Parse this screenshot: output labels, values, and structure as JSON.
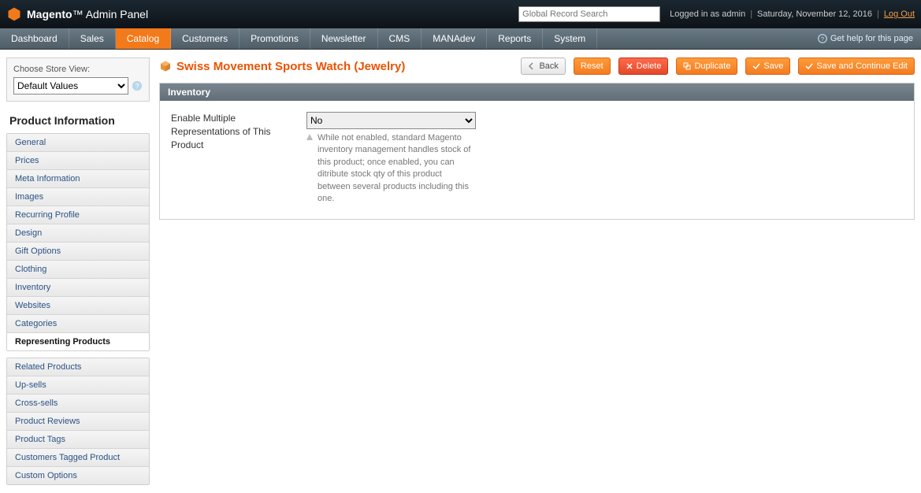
{
  "header": {
    "brand1": "Magento",
    "brand2": "Admin Panel",
    "search_placeholder": "Global Record Search",
    "logged_in": "Logged in as admin",
    "date": "Saturday, November 12, 2016",
    "logout": "Log Out"
  },
  "nav": {
    "items": [
      "Dashboard",
      "Sales",
      "Catalog",
      "Customers",
      "Promotions",
      "Newsletter",
      "CMS",
      "MANAdev",
      "Reports",
      "System"
    ],
    "active_index": 2,
    "help": "Get help for this page"
  },
  "store_view": {
    "label": "Choose Store View:",
    "value": "Default Values"
  },
  "sidebar": {
    "title": "Product Information",
    "group1": [
      "General",
      "Prices",
      "Meta Information",
      "Images",
      "Recurring Profile",
      "Design",
      "Gift Options",
      "Clothing",
      "Inventory",
      "Websites",
      "Categories",
      "Representing Products"
    ],
    "group1_active_index": 11,
    "group2": [
      "Related Products",
      "Up-sells",
      "Cross-sells",
      "Product Reviews",
      "Product Tags",
      "Customers Tagged Product",
      "Custom Options"
    ]
  },
  "page": {
    "title": "Swiss Movement Sports Watch (Jewelry)",
    "buttons": {
      "back": "Back",
      "reset": "Reset",
      "delete": "Delete",
      "duplicate": "Duplicate",
      "save": "Save",
      "save_continue": "Save and Continue Edit"
    }
  },
  "panel": {
    "title": "Inventory",
    "field_label": "Enable Multiple Representations of This Product",
    "field_value": "No",
    "field_note": "While not enabled, standard Magento inventory management handles stock of this product; once enabled, you can ditribute stock qty of this product between several products including this one."
  }
}
